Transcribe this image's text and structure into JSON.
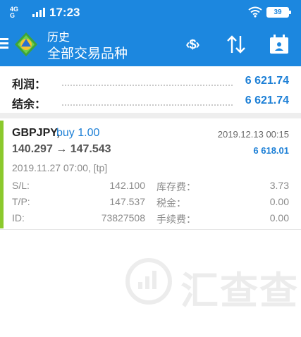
{
  "status_bar": {
    "network_top": "4G",
    "network_sim": "G",
    "time": "17:23",
    "battery": "39"
  },
  "toolbar": {
    "title": "历史",
    "subtitle": "全部交易品种",
    "currency_icon_text": "‹$›"
  },
  "summary": {
    "profit_label": "利润：",
    "profit_value": "6 621.74",
    "balance_label": "结余：",
    "balance_value": "6 621.74"
  },
  "trade": {
    "symbol": "GBPJPY,",
    "side": "buy 1.00",
    "close_time": "2019.12.13 00:15",
    "prices": "140.297 → 147.543",
    "profit": "6 618.01",
    "open_time": "2019.11.27 07:00, [tp]",
    "sl_label": "S/L:",
    "sl_value": "142.100",
    "tp_label": "T/P:",
    "tp_value": "147.537",
    "id_label": "ID:",
    "id_value": "73827508",
    "swap_label": "库存费：",
    "swap_value": "3.73",
    "tax_label": "税金：",
    "tax_value": "0.00",
    "commission_label": "手续费：",
    "commission_value": "0.00"
  },
  "watermark": {
    "text": "汇查查"
  },
  "colors": {
    "header_blue": "#1c87df",
    "value_blue": "#1c7fd6",
    "accent_green": "#8bc92c"
  }
}
